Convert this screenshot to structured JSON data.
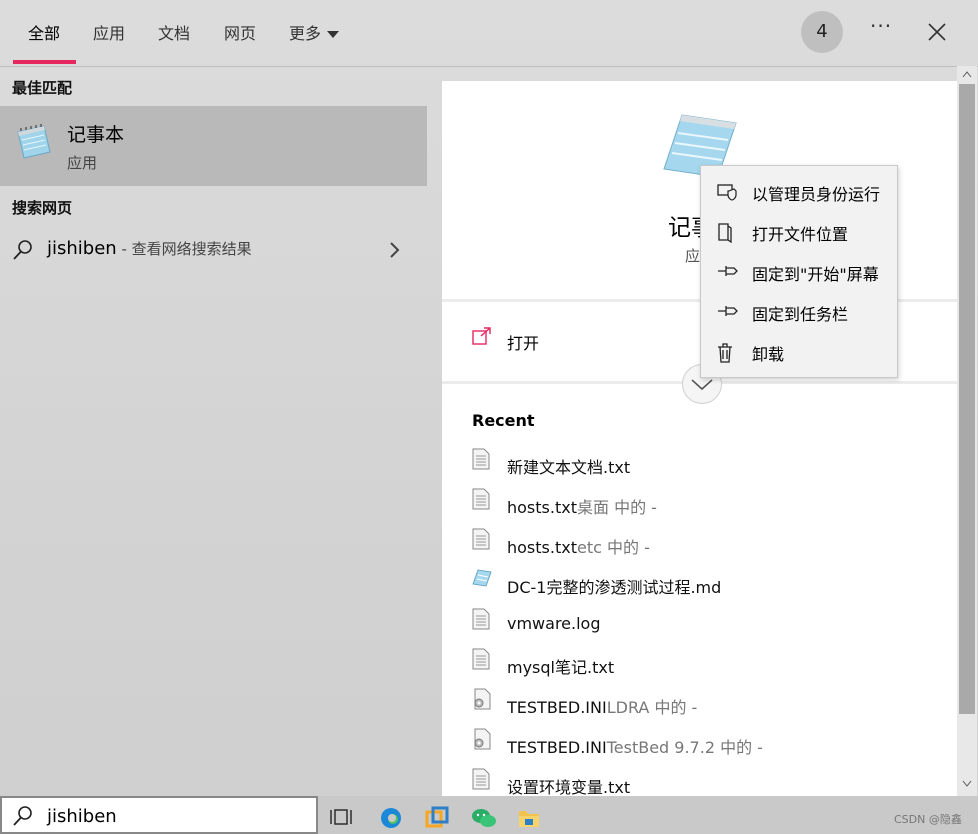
{
  "tabs": [
    {
      "label": "全部"
    },
    {
      "label": "应用"
    },
    {
      "label": "文档"
    },
    {
      "label": "网页"
    },
    {
      "label": "更多"
    }
  ],
  "header": {
    "badge_count": "4",
    "more_label": "···"
  },
  "left": {
    "best_match_title": "最佳匹配",
    "best_match": {
      "name": "记事本",
      "type": "应用"
    },
    "web_title": "搜索网页",
    "web_result": {
      "query": "jishiben",
      "suffix": " - 查看网络搜索结果"
    }
  },
  "detail": {
    "app_name": "记事本",
    "app_type": "应用",
    "open_label": "打开",
    "recent_title": "Recent",
    "recent": [
      {
        "name": "新建文本文档.txt",
        "location": "",
        "icon": "text-file-icon"
      },
      {
        "name": "hosts.txt",
        "location": "桌面 中的 -",
        "icon": "text-file-icon"
      },
      {
        "name": "hosts.txt",
        "location": "etc 中的 -",
        "icon": "text-file-icon"
      },
      {
        "name": "DC-1完整的渗透测试过程.md",
        "location": "",
        "icon": "notepad-icon"
      },
      {
        "name": "vmware.log",
        "location": "",
        "icon": "text-file-icon"
      },
      {
        "name": "mysql笔记.txt",
        "location": "",
        "icon": "text-file-icon"
      },
      {
        "name": "TESTBED.INI",
        "location": "LDRA 中的 -",
        "icon": "ini-file-icon"
      },
      {
        "name": "TESTBED.INI",
        "location": "TestBed 9.7.2 中的 -",
        "icon": "ini-file-icon"
      },
      {
        "name": "设置环境变量.txt",
        "location": "",
        "icon": "text-file-icon"
      }
    ]
  },
  "context_menu": [
    {
      "label": "以管理员身份运行",
      "icon": "run-as-admin-icon"
    },
    {
      "label": "打开文件位置",
      "icon": "open-location-icon"
    },
    {
      "label": "固定到\"开始\"屏幕",
      "icon": "pin-icon"
    },
    {
      "label": "固定到任务栏",
      "icon": "pin-icon"
    },
    {
      "label": "卸载",
      "icon": "trash-icon"
    }
  ],
  "search": {
    "value": "jishiben"
  },
  "taskbar": {
    "icons": [
      "task-view-icon",
      "edge-icon",
      "vmware-icon",
      "wechat-icon",
      "file-explorer-icon"
    ]
  },
  "watermark": "CSDN @隐鑫"
}
